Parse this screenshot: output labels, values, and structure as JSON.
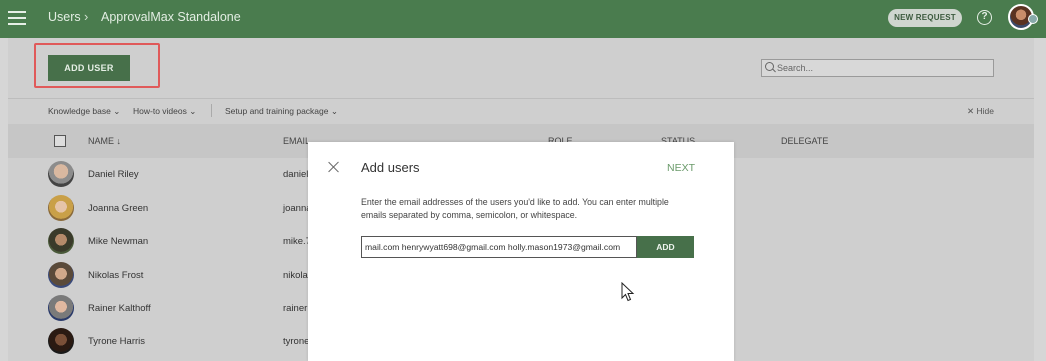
{
  "topbar": {
    "breadcrumb_users": "Users",
    "breadcrumb_sep": "›",
    "breadcrumb_org": "ApprovalMax Standalone",
    "new_request_label": "NEW REQUEST",
    "help_label": "?",
    "accent_color": "#4a7c4e"
  },
  "toolbar": {
    "add_user_label": "ADD USER",
    "search_placeholder": "Search..."
  },
  "sublinks": {
    "knowledge_base": "Knowledge base ⌄",
    "howto": "How-to videos ⌄",
    "setup": "Setup and training package ⌄",
    "hide": "✕ Hide"
  },
  "table": {
    "headers": {
      "name": "NAME ↓",
      "email": "EMAIL",
      "role": "ROLE",
      "status": "STATUS",
      "delegate": "DELEGATE"
    },
    "rows": [
      {
        "name": "Daniel Riley",
        "email": "daniel"
      },
      {
        "name": "Joanna Green",
        "email": "joanna"
      },
      {
        "name": "Mike Newman",
        "email": "mike.7"
      },
      {
        "name": "Nikolas Frost",
        "email": "nikola"
      },
      {
        "name": "Rainer Kalthoff",
        "email": "rainer"
      },
      {
        "name": "Tyrone Harris",
        "email": "tyrone"
      }
    ]
  },
  "modal": {
    "title": "Add users",
    "next_label": "NEXT",
    "instructions": "Enter the email addresses of the users you'd like to add. You can enter multiple emails separated by comma, semicolon, or whitespace.",
    "email_value": "mail.com henrywyatt698@gmail.com holly.mason1973@gmail.com",
    "add_label": "ADD"
  }
}
